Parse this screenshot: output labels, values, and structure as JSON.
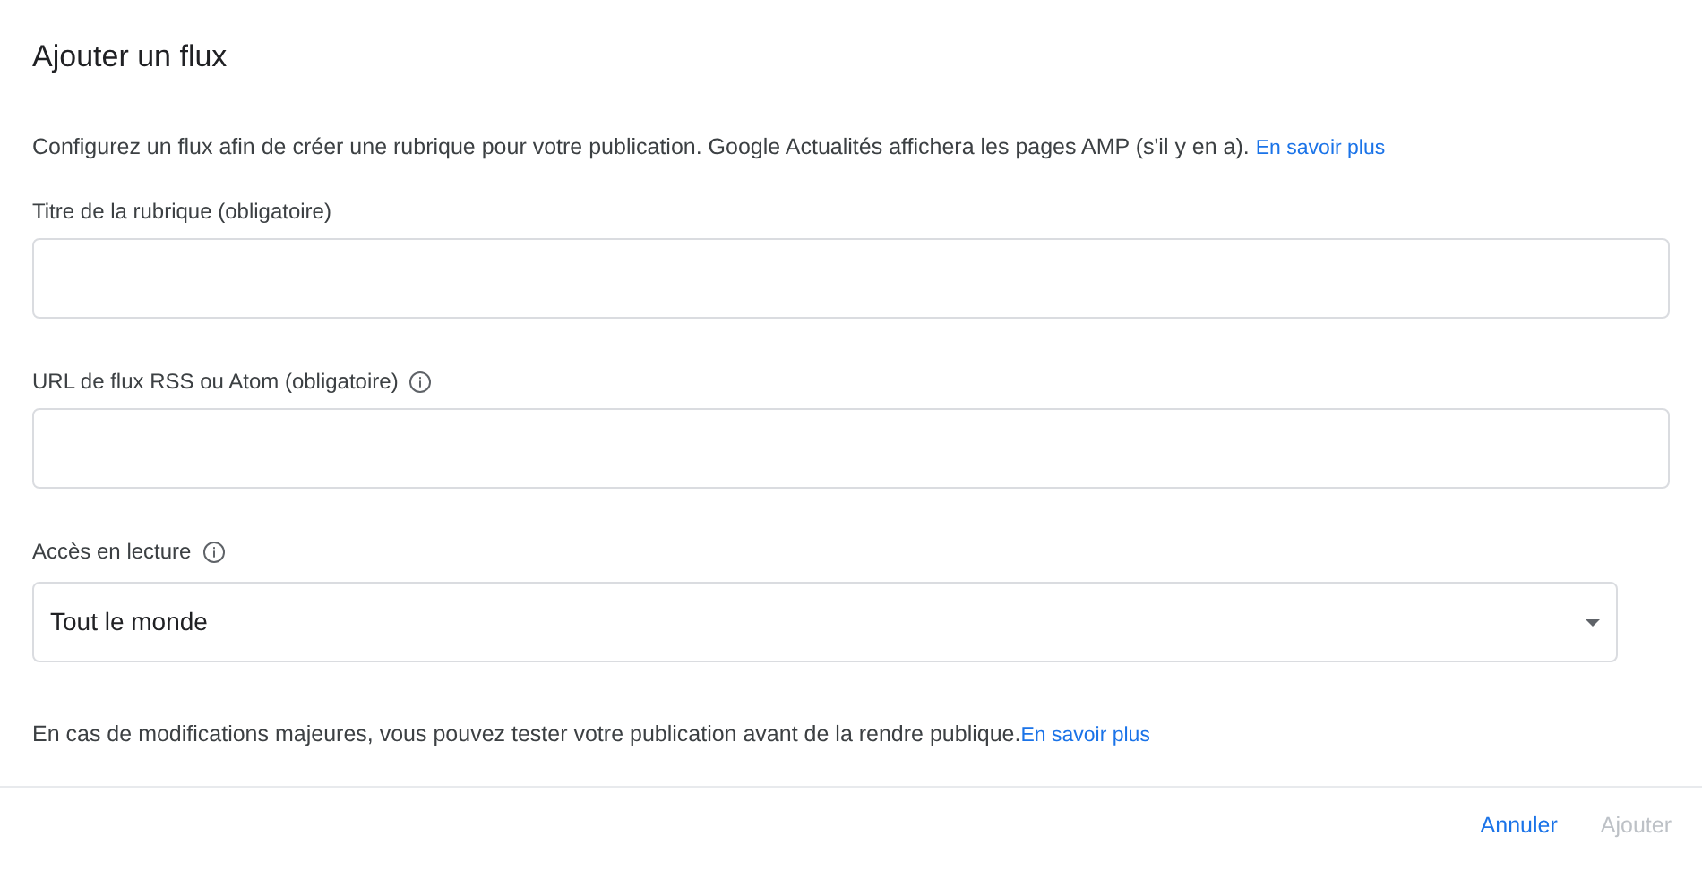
{
  "dialog": {
    "title": "Ajouter un flux"
  },
  "description": {
    "text": "Configurez un flux afin de créer une rubrique pour votre publication. Google Actualités affichera les pages AMP (s'il y en a).",
    "link": "En savoir plus"
  },
  "fields": [
    {
      "kind": "text",
      "label": "Titre de la rubrique (obligatoire)",
      "info": false
    },
    {
      "kind": "text",
      "label": "URL de flux RSS ou Atom (obligatoire)",
      "info": true
    },
    {
      "kind": "select",
      "label": "Accès en lecture",
      "info": true,
      "value": "Tout le monde"
    }
  ],
  "note": {
    "text": "En cas de modifications majeures, vous pouvez tester votre publication avant de la rendre publique.",
    "link": "En savoir plus"
  },
  "buttons": [
    {
      "label": "Annuler",
      "disabled": false
    },
    {
      "label": "Ajouter",
      "disabled": true
    }
  ]
}
